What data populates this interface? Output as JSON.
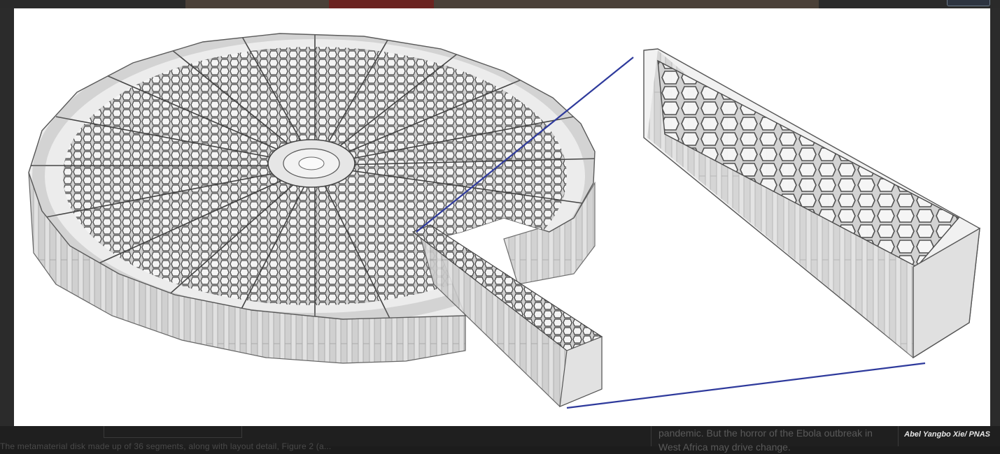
{
  "figure": {
    "credit": "Abel Yangbo Xie/ PNAS",
    "accent_line_color": "#2e3a9c"
  },
  "background_page": {
    "caption_text": "The metamaterial disk made up of 36 segments, along with layout detail, Figure 2 (a...",
    "article_text": "pandemic. But the horror of the Ebola outbreak in West Africa may drive change."
  }
}
